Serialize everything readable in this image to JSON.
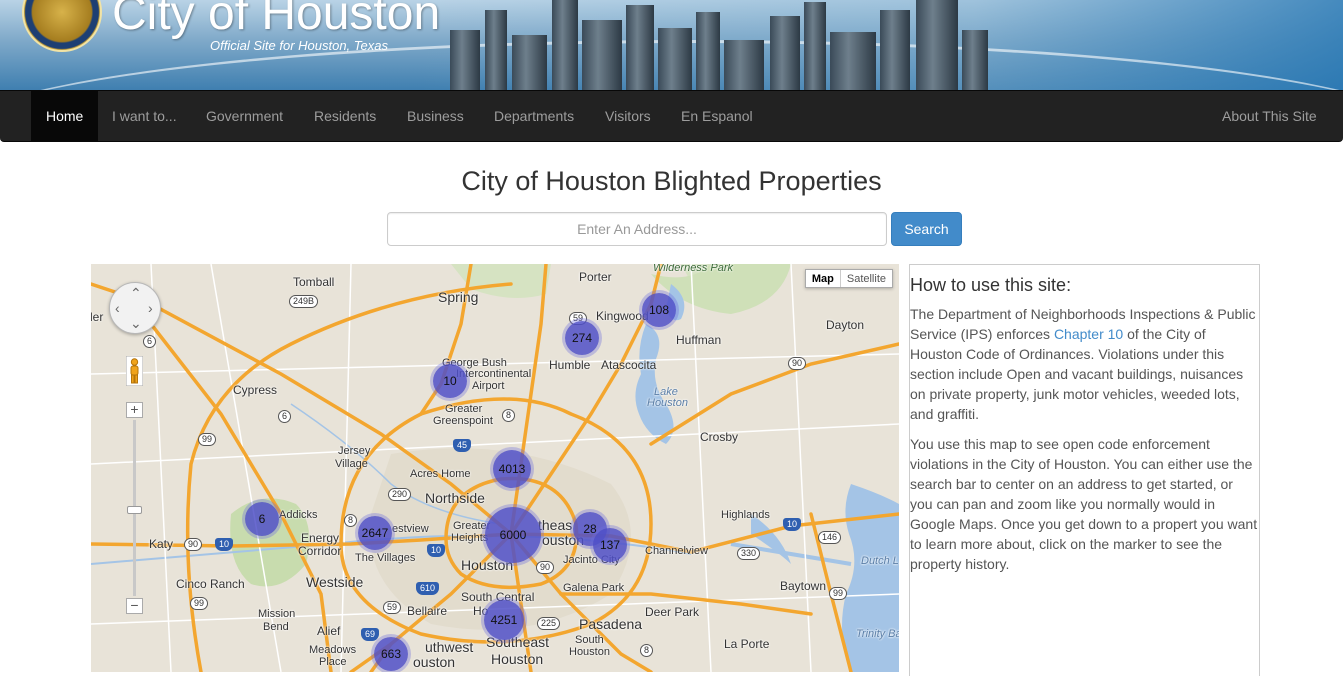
{
  "banner": {
    "title": "City of Houston",
    "subtitle": "Official Site for Houston, Texas"
  },
  "nav": {
    "items": [
      "Home",
      "I want to...",
      "Government",
      "Residents",
      "Business",
      "Departments",
      "Visitors",
      "En Espanol"
    ],
    "right_item": "About This Site",
    "active": "Home"
  },
  "page": {
    "title": "City of Houston Blighted Properties"
  },
  "search": {
    "placeholder": "Enter An Address...",
    "button_label": "Search"
  },
  "map": {
    "map_type_options": [
      "Map",
      "Satellite"
    ],
    "selected_map_type": "Map",
    "zoom_in_label": "+",
    "zoom_out_label": "−",
    "clusters": [
      "108",
      "274",
      "10",
      "4013",
      "6",
      "2647",
      "6000",
      "28",
      "137",
      "4251",
      "663"
    ],
    "labels": {
      "tomball": "Tomball",
      "porter": "Porter",
      "wilderness_park": "Wilderness Park",
      "spring": "Spring",
      "kingwood": "Kingwood",
      "dayton": "Dayton",
      "huffman": "Huffman",
      "humble": "Humble",
      "atascocita": "Atascocita",
      "george_bush": "George Bush",
      "intercontinental": "Intercontinental",
      "airport": "Airport",
      "cypress": "Cypress",
      "lake_houston_1": "Lake",
      "lake_houston_2": "Houston",
      "greater": "Greater",
      "greenspoint": "Greenspoint",
      "crosby": "Crosby",
      "jersey": "Jersey",
      "village": "Village",
      "acres_home": "Acres Home",
      "northside": "Northside",
      "addicks": "Addicks",
      "highlands": "Highlands",
      "energy": "Energy",
      "corridor": "Corridor",
      "westview": "estview",
      "greater_heights_1": "Greater",
      "greater_heights_2": "Heights",
      "the_villages": "The Villages",
      "katy": "Katy",
      "channelview": "Channelview",
      "houston": "Houston",
      "eastex": "theas",
      "ouston": "ouston",
      "jacinto": "Jacinto City",
      "cinco_ranch": "Cinco Ranch",
      "westside": "Westside",
      "baytown": "Baytown",
      "galena_park": "Galena Park",
      "south_central": "South Central",
      "bellaire": "Bellaire",
      "ho": "Ho",
      "deer_park": "Deer Park",
      "mission": "Mission",
      "bend": "Bend",
      "alief": "Alief",
      "pasadena": "Pasadena",
      "meadows": "Meadows",
      "place": "Place",
      "southwest_1": "uthwest",
      "southwest_2": "ouston",
      "southeast_1": "Southeast",
      "southeast_2": "Houston",
      "south_houston_1": "South",
      "south_houston_2": "Houston",
      "la_porte": "La Porte",
      "trinity_bay": "Trinity Ba",
      "dutch_l": "Dutch L",
      "ler": "ler"
    },
    "shields": {
      "s249b": "249B",
      "s6a": "6",
      "s59a": "59",
      "s90a": "90",
      "s6b": "6",
      "s8": "8",
      "s99a": "99",
      "s45": "45",
      "s290": "290",
      "s8b": "8",
      "s90b": "90",
      "s10a": "10",
      "s10b": "10",
      "s330": "330",
      "s146": "146",
      "s10c": "10",
      "s610": "610",
      "s90c": "90",
      "s99b": "99",
      "s59b": "59",
      "s69": "69",
      "s99c": "99",
      "s225": "225",
      "s8c": "8",
      "s99d": "99"
    }
  },
  "info": {
    "heading": "How to use this site:",
    "p1_before": "The Department of Neighborhoods Inspections & Public Service (IPS) enforces ",
    "p1_link": "Chapter 10",
    "p1_after": " of the City of Houston Code of Ordinances. Violations under this section include Open and vacant buildings, nuisances on private property, junk motor vehicles, weeded lots, and graffiti.",
    "p2": "You use this map to see open code enforcement violations in the City of Houston. You can either use the search bar to center on an address to get started, or you can pan and zoom like you normally would in Google Maps. Once you get down to a propert you want to learn more about, click on the marker to see the property history."
  },
  "colors": {
    "navbar_bg": "#222222",
    "nav_text": "#9d9d9d",
    "button_primary": "#428bca",
    "link": "#428bca",
    "cluster": "#5050c8",
    "highway": "#f3a62f"
  }
}
